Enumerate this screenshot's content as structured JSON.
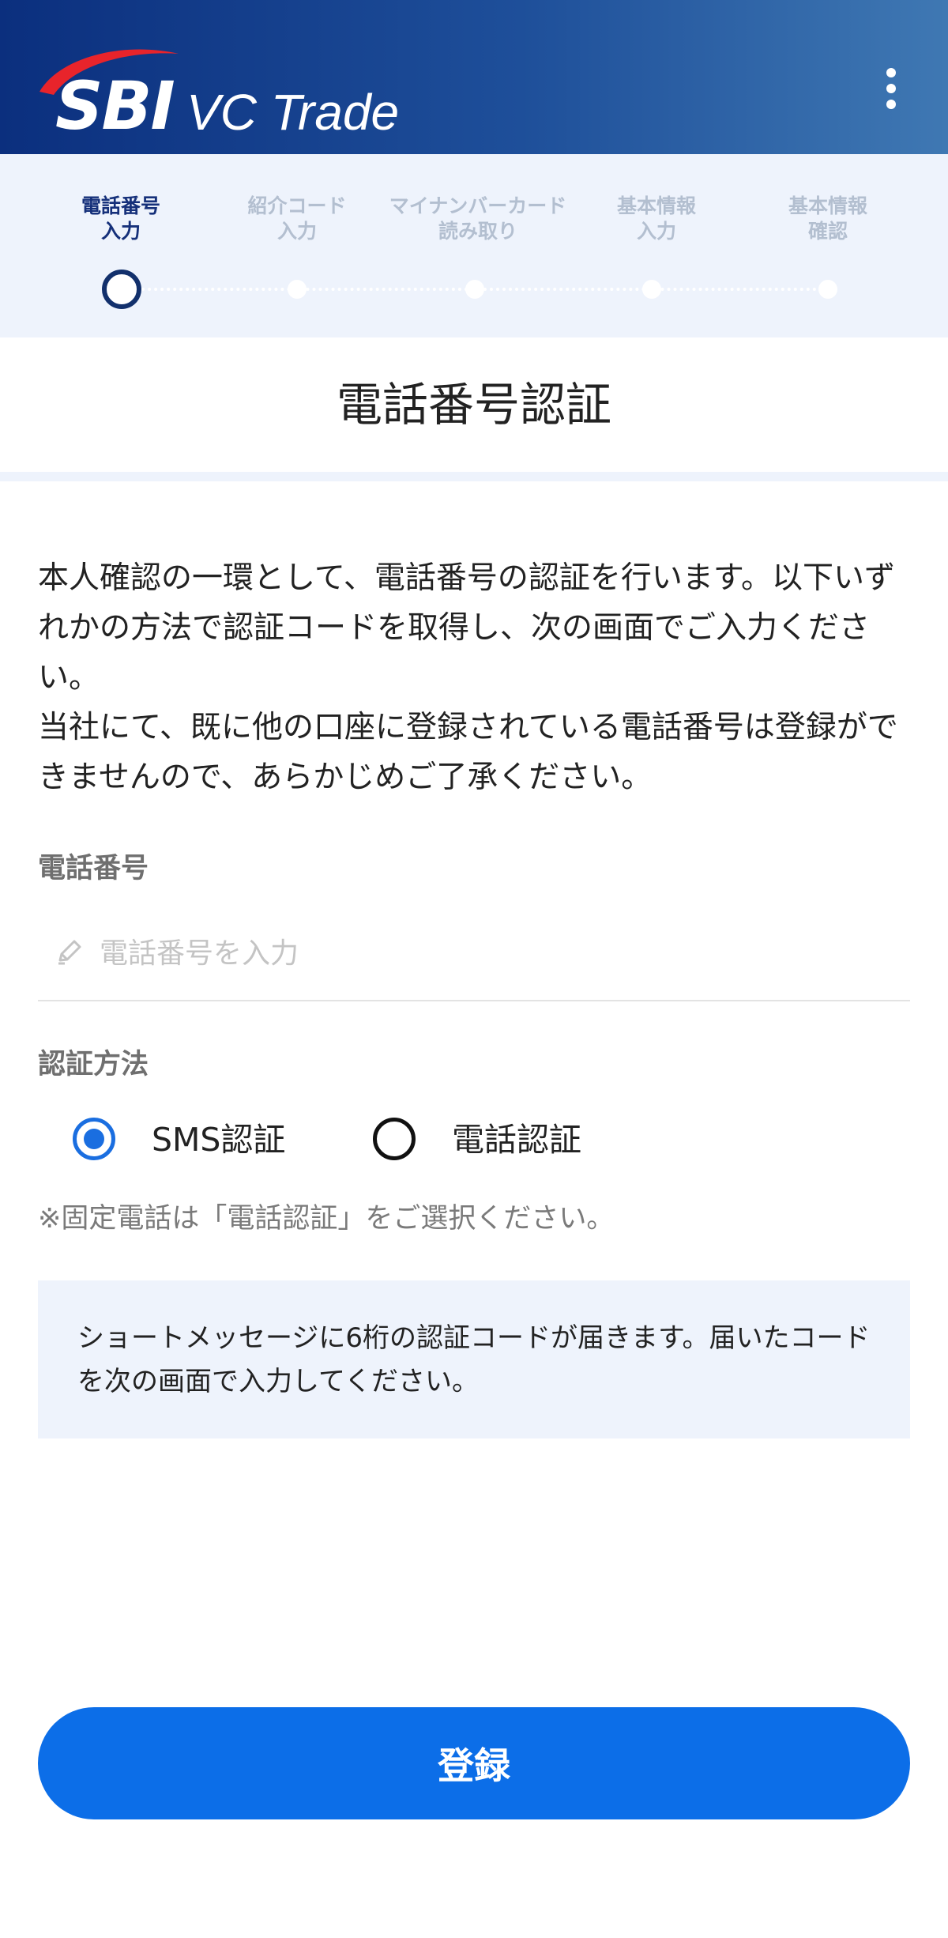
{
  "app": {
    "logo_brand": "SBI",
    "logo_product": "VC Trade",
    "menu_icon": "more-vertical-icon"
  },
  "steps": [
    {
      "line1": "電話番号",
      "line2": "入力",
      "active": true
    },
    {
      "line1": "紹介コード",
      "line2": "入力",
      "active": false
    },
    {
      "line1": "マイナンバーカード",
      "line2": "読み取り",
      "active": false
    },
    {
      "line1": "基本情報",
      "line2": "入力",
      "active": false
    },
    {
      "line1": "基本情報",
      "line2": "確認",
      "active": false
    }
  ],
  "page": {
    "title": "電話番号認証",
    "description": [
      "本人確認の一環として、電話番号の認証を行います。以下いずれかの方法で認証コードを取得し、次の画面でご入力ください。",
      "当社にて、既に他の口座に登録されている電話番号は登録ができませんので、あらかじめご了承ください。"
    ]
  },
  "form": {
    "phone": {
      "label": "電話番号",
      "placeholder": "電話番号を入力",
      "value": "",
      "icon": "pencil-icon"
    },
    "method": {
      "label": "認証方法",
      "options": [
        {
          "label": "SMS認証",
          "selected": true
        },
        {
          "label": "電話認証",
          "selected": false
        }
      ],
      "note": "※固定電話は「電話認証」をご選択ください。"
    },
    "info": "ショートメッセージに6桁の認証コードが届きます。届いたコードを次の画面で入力してください。",
    "submit_label": "登録"
  },
  "colors": {
    "header_start": "#0b2f7e",
    "header_end": "#3f78b3",
    "accent": "#0c6ee8",
    "step_active": "#15307a",
    "step_inactive": "#b3bfd0",
    "panel_bg": "#eef3fc"
  }
}
